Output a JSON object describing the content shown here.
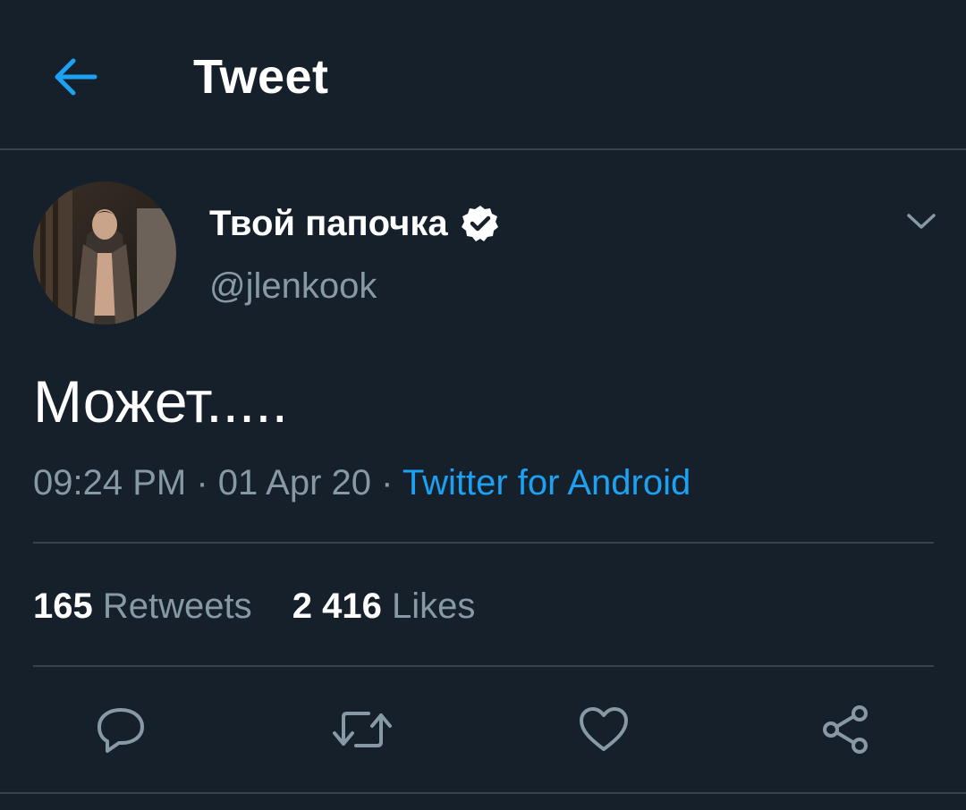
{
  "header": {
    "title": "Tweet",
    "back_icon": "arrow-left-icon"
  },
  "tweet": {
    "display_name": "Твой папочка",
    "verified": true,
    "handle": "@jlenkook",
    "text": "Может.....",
    "time": "09:24 PM",
    "separator": " · ",
    "date": "01 Apr 20",
    "source": "Twitter for Android",
    "stats": {
      "retweets_count": "165",
      "retweets_label": "Retweets",
      "likes_count": "2 416",
      "likes_label": "Likes"
    }
  },
  "actions": [
    {
      "name": "reply",
      "icon": "reply-icon"
    },
    {
      "name": "retweet",
      "icon": "retweet-icon"
    },
    {
      "name": "like",
      "icon": "heart-icon"
    },
    {
      "name": "share",
      "icon": "share-icon"
    }
  ],
  "colors": {
    "background": "#15202b",
    "divider": "#38444d",
    "secondary_text": "#8899a6",
    "accent": "#1da1f2",
    "primary_text": "#ffffff"
  }
}
